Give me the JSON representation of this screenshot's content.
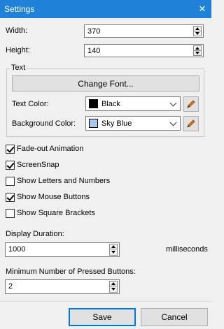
{
  "window": {
    "title": "Settings",
    "close_glyph": "✕"
  },
  "size": {
    "width_label": "Width:",
    "width_value": "370",
    "height_label": "Height:",
    "height_value": "140"
  },
  "text_group": {
    "label": "Text",
    "change_font_label": "Change Font...",
    "text_color_label": "Text Color:",
    "text_color_value": "Black",
    "text_color_swatch": "#000000",
    "bg_color_label": "Background Color:",
    "bg_color_value": "Sky Blue",
    "bg_color_swatch": "#a7c7ee"
  },
  "options": [
    {
      "label": "Fade-out Animation",
      "checked": true
    },
    {
      "label": "ScreenSnap",
      "checked": true
    },
    {
      "label": "Show Letters and Numbers",
      "checked": false
    },
    {
      "label": "Show Mouse Buttons",
      "checked": true
    },
    {
      "label": "Show Square Brackets",
      "checked": false
    }
  ],
  "duration": {
    "label": "Display Duration:",
    "value": "1000",
    "unit": "milliseconds"
  },
  "min_buttons": {
    "label": "Minimum Number of Pressed Buttons:",
    "value": "2"
  },
  "footer": {
    "save_label": "Save",
    "cancel_label": "Cancel"
  },
  "colors": {
    "titlebar": "#1f81d8",
    "accent": "#0078d7",
    "pencil": "#e07a1f"
  }
}
